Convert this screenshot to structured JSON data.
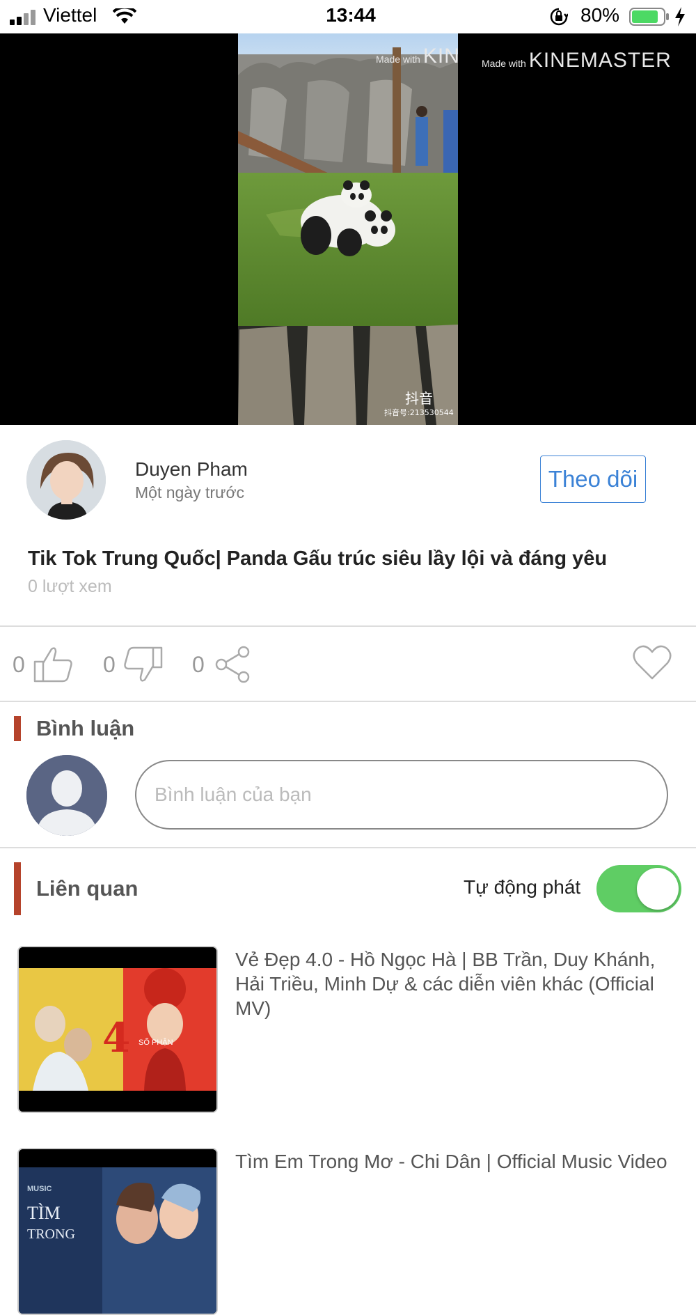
{
  "status_bar": {
    "carrier": "Viettel",
    "time": "13:44",
    "battery_percent": "80%"
  },
  "video": {
    "watermark_top_left": "Made with KINEMASTER",
    "watermark_top_right": "Made with KINEMASTER",
    "watermark_made_with": "Made with",
    "watermark_brand": "KINEMASTER",
    "douyin_logo": "抖音",
    "douyin_id": "抖音号:213530544"
  },
  "author": {
    "name": "Duyen Pham",
    "posted": "Một ngày trước",
    "follow_label": "Theo dõi"
  },
  "video_info": {
    "title": "Tik Tok Trung Quốc| Panda Gấu trúc siêu lầy lội và đáng yêu",
    "views": "0 lượt xem"
  },
  "actions": {
    "likes": "0",
    "dislikes": "0",
    "shares": "0"
  },
  "comments": {
    "section_title": "Bình luận",
    "input_placeholder": "Bình luận của bạn"
  },
  "related": {
    "section_title": "Liên quan",
    "autoplay_label": "Tự động phát",
    "autoplay_on": true,
    "items": [
      {
        "title": "Vẻ Đẹp 4.0 - Hồ Ngọc Hà | BB Trần, Duy Khánh, Hải Triều, Minh Dự & các diễn viên khác (Official MV)"
      },
      {
        "title": "Tìm Em Trong Mơ - Chi Dân | Official Music Video"
      }
    ]
  },
  "colors": {
    "accent_blue": "#3b82d6",
    "section_bar": "#b5432b",
    "toggle_on": "#5fcd64",
    "battery_green": "#4cd964"
  }
}
